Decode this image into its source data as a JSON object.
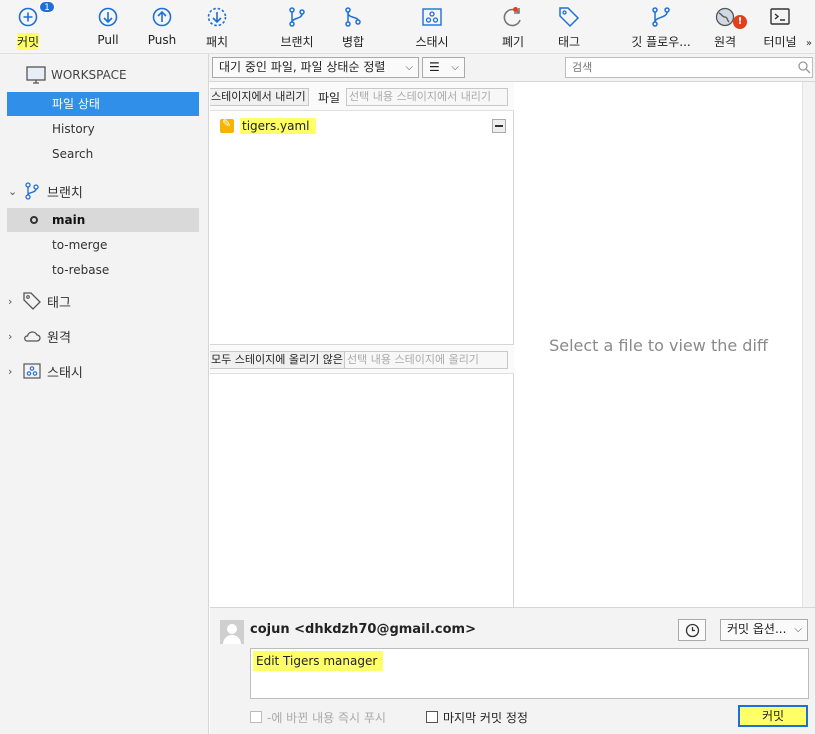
{
  "toolbar": {
    "commit": {
      "label": "커밋",
      "badge": "1"
    },
    "pull": {
      "label": "Pull"
    },
    "push": {
      "label": "Push"
    },
    "patch": {
      "label": "패치"
    },
    "branch": {
      "label": "브랜치"
    },
    "merge": {
      "label": "병합"
    },
    "stash": {
      "label": "스태시"
    },
    "discard": {
      "label": "폐기"
    },
    "tag": {
      "label": "태그"
    },
    "gitflow": {
      "label": "깃 플로우..."
    },
    "remote": {
      "label": "원격",
      "alert": "!"
    },
    "terminal": {
      "label": "터미널"
    },
    "more": "»"
  },
  "sidebar": {
    "workspace": {
      "label": "WORKSPACE",
      "items": [
        {
          "label": "파일 상태",
          "selected": true
        },
        {
          "label": "History"
        },
        {
          "label": "Search"
        }
      ]
    },
    "branches": {
      "label": "브랜치",
      "expanded": true,
      "items": [
        {
          "label": "main",
          "current": true
        },
        {
          "label": "to-merge"
        },
        {
          "label": "to-rebase"
        }
      ]
    },
    "tags": {
      "label": "태그"
    },
    "remotes": {
      "label": "원격"
    },
    "stashes": {
      "label": "스태시"
    }
  },
  "filterbar": {
    "file_filter": "대기 중인 파일, 파일 상태순 정렬",
    "view_mode": "☰",
    "search_placeholder": "검색"
  },
  "staged": {
    "unstage_all": "스테이지에서 내리기",
    "files_label": "파일",
    "unstage_selected": "선택 내용 스테이지에서 내리기",
    "files": [
      {
        "name": "tigers.yaml",
        "status": "modified"
      }
    ]
  },
  "unstaged": {
    "header_overlap": "모두 스테이지에 올리기 않은 파일",
    "stage_selected": "선택 내용 스테이지에 올리기",
    "files": []
  },
  "diff": {
    "placeholder": "Select a file to view the diff"
  },
  "commit": {
    "author": "cojun <dhkdzh70@gmail.com>",
    "options": "커밋 옵션...",
    "message": "Edit Tigers manager",
    "push_immediately": "-에 바뀐 내용 즉시 푸시",
    "amend_last": "마지막 커밋 정정",
    "commit_button": "커밋"
  },
  "colors": {
    "accent": "#2f8fe9",
    "highlight": "#ffff66",
    "alert": "#e0401a"
  }
}
